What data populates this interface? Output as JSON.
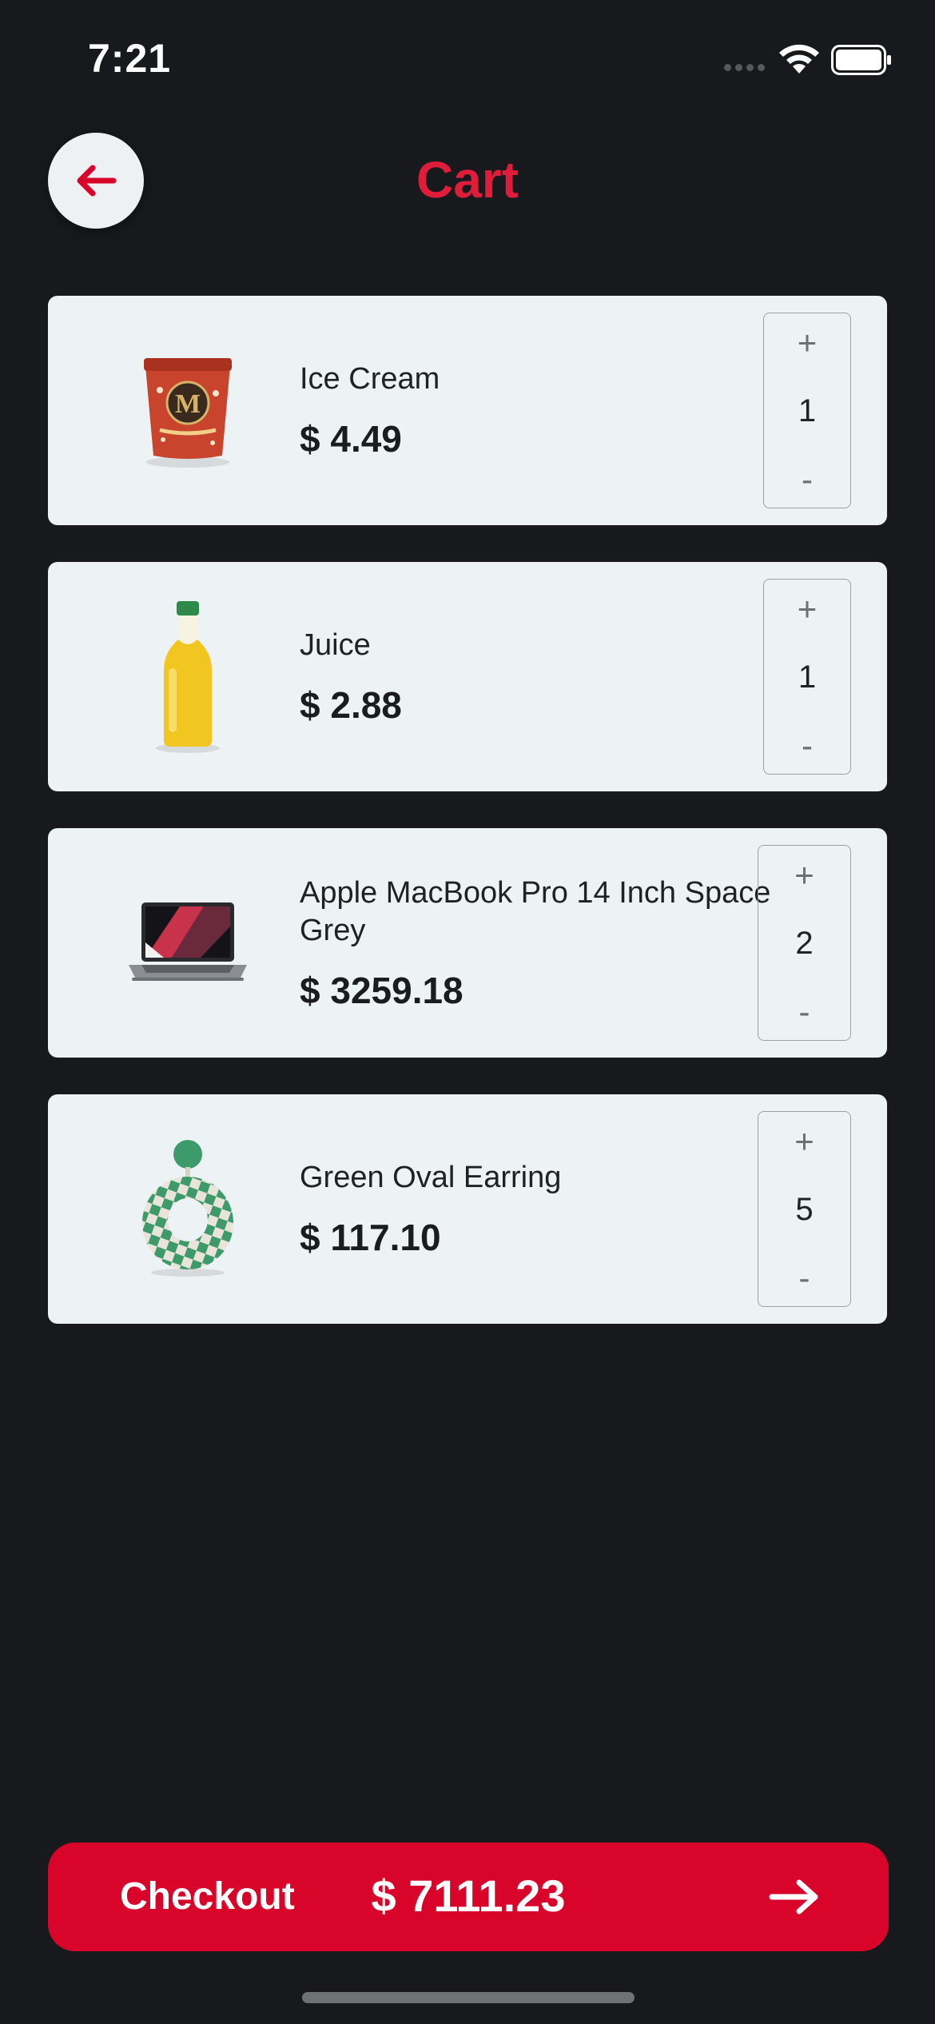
{
  "status_bar": {
    "time": "7:21"
  },
  "header": {
    "title": "Cart",
    "back_icon": "arrow-left-icon"
  },
  "cart": {
    "items": [
      {
        "name": "Ice Cream",
        "price": "$ 4.49",
        "quantity": "1",
        "image": "ice-cream-tub"
      },
      {
        "name": "Juice",
        "price": "$ 2.88",
        "quantity": "1",
        "image": "juice-bottle"
      },
      {
        "name": "Apple MacBook Pro 14 Inch Space Grey",
        "price": "$ 3259.18",
        "quantity": "2",
        "image": "laptop"
      },
      {
        "name": "Green Oval Earring",
        "price": "$ 117.10",
        "quantity": "5",
        "image": "earring"
      }
    ],
    "increment_label": "+",
    "decrement_label": "-"
  },
  "checkout": {
    "label": "Checkout",
    "total": "$ 7111.23",
    "icon": "arrow-right-icon"
  },
  "colors": {
    "background": "#17191d",
    "accent": "#d90429",
    "title": "#df1c3a",
    "card": "#edf2f5"
  }
}
